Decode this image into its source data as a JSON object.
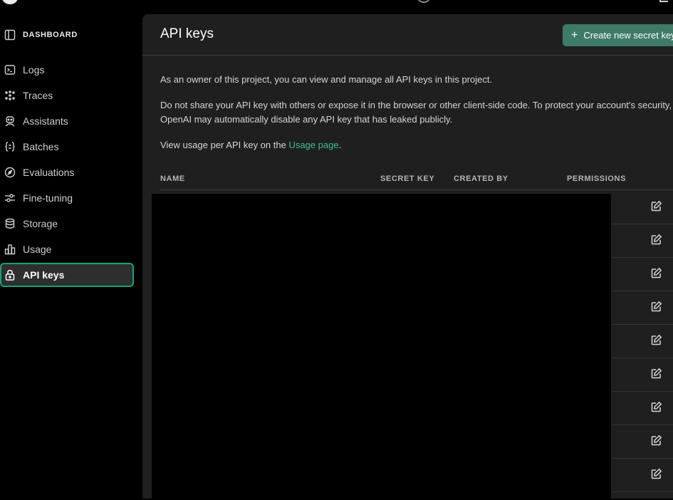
{
  "sidebar": {
    "header": {
      "label": "DASHBOARD",
      "icon": "sidebar-panel-icon"
    },
    "items": [
      {
        "label": "Logs",
        "icon": "terminal-icon"
      },
      {
        "label": "Traces",
        "icon": "traces-icon"
      },
      {
        "label": "Assistants",
        "icon": "robot-icon"
      },
      {
        "label": "Batches",
        "icon": "braces-icon"
      },
      {
        "label": "Evaluations",
        "icon": "compass-icon"
      },
      {
        "label": "Fine-tuning",
        "icon": "sliders-icon"
      },
      {
        "label": "Storage",
        "icon": "database-icon"
      },
      {
        "label": "Usage",
        "icon": "bar-chart-icon"
      },
      {
        "label": "API keys",
        "icon": "lock-icon",
        "active": true
      }
    ]
  },
  "main": {
    "title": "API keys",
    "create_button": "Create new secret key",
    "paragraph1": "As an owner of this project, you can view and manage all API keys in this project.",
    "paragraph2": "Do not share your API key with others or expose it in the browser or other client-side code. To protect your account's security, OpenAI may automatically disable any API key that has leaked publicly.",
    "usage_prefix": "View usage per API key on the ",
    "usage_link": "Usage page",
    "usage_suffix": ".",
    "columns": [
      "NAME",
      "SECRET KEY",
      "CREATED BY",
      "PERMISSIONS"
    ],
    "row_count": 9
  },
  "colors": {
    "accent": "#10a37f",
    "button": "#3d7a67",
    "link": "#3fbf8f",
    "panel": "#1f1f1f"
  }
}
